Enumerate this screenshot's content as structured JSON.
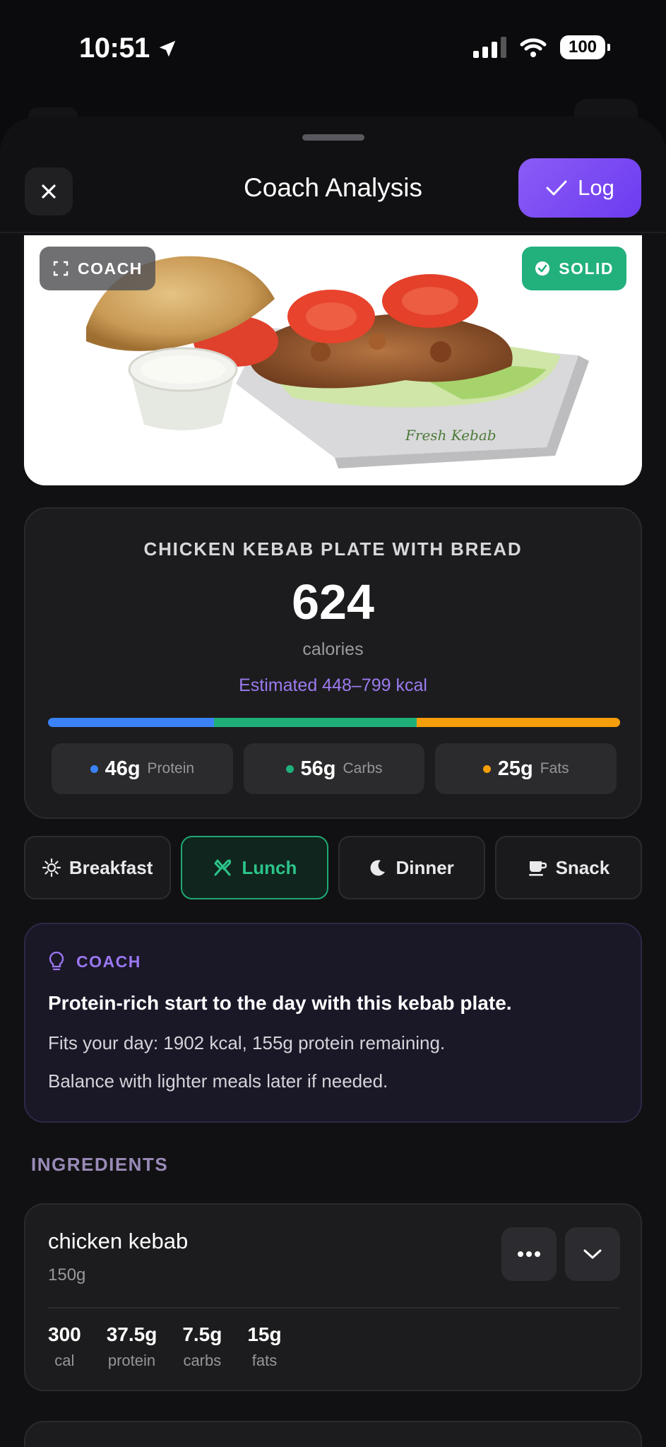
{
  "status": {
    "time": "10:51",
    "battery": "100"
  },
  "header": {
    "title": "Coach Analysis",
    "log_label": "Log"
  },
  "photo": {
    "coach_chip": "COACH",
    "solid_chip": "SOLID",
    "box_brand": "Fresh Kebab"
  },
  "meal": {
    "name": "CHICKEN KEBAB PLATE WITH BREAD",
    "calories": "624",
    "calories_unit": "calories",
    "estimate": "Estimated 448–799 kcal",
    "macros": [
      {
        "value": "46g",
        "label": "Protein",
        "color": "#3b82f6",
        "share": 0.29
      },
      {
        "value": "56g",
        "label": "Carbs",
        "color": "#1fb07a",
        "share": 0.355
      },
      {
        "value": "25g",
        "label": "Fats",
        "color": "#f59e0b",
        "share": 0.355
      }
    ]
  },
  "meal_types": [
    {
      "label": "Breakfast",
      "icon": "sun-icon",
      "selected": false
    },
    {
      "label": "Lunch",
      "icon": "utensils-icon",
      "selected": true
    },
    {
      "label": "Dinner",
      "icon": "moon-icon",
      "selected": false
    },
    {
      "label": "Snack",
      "icon": "cup-icon",
      "selected": false
    }
  ],
  "coach": {
    "label": "COACH",
    "headline": "Protein-rich start to the day with this kebab plate.",
    "line1": "Fits your day: 1902 kcal, 155g protein remaining.",
    "line2": "Balance with lighter meals later if needed."
  },
  "ingredients_label": "INGREDIENTS",
  "ingredient": {
    "name": "chicken kebab",
    "weight": "150g",
    "stats": [
      {
        "value": "300",
        "label": "cal"
      },
      {
        "value": "37.5g",
        "label": "protein"
      },
      {
        "value": "7.5g",
        "label": "carbs"
      },
      {
        "value": "15g",
        "label": "fats"
      }
    ]
  },
  "colors": {
    "accent": "#7c4bf3",
    "green": "#22b07d",
    "background": "#0b0b0d"
  }
}
